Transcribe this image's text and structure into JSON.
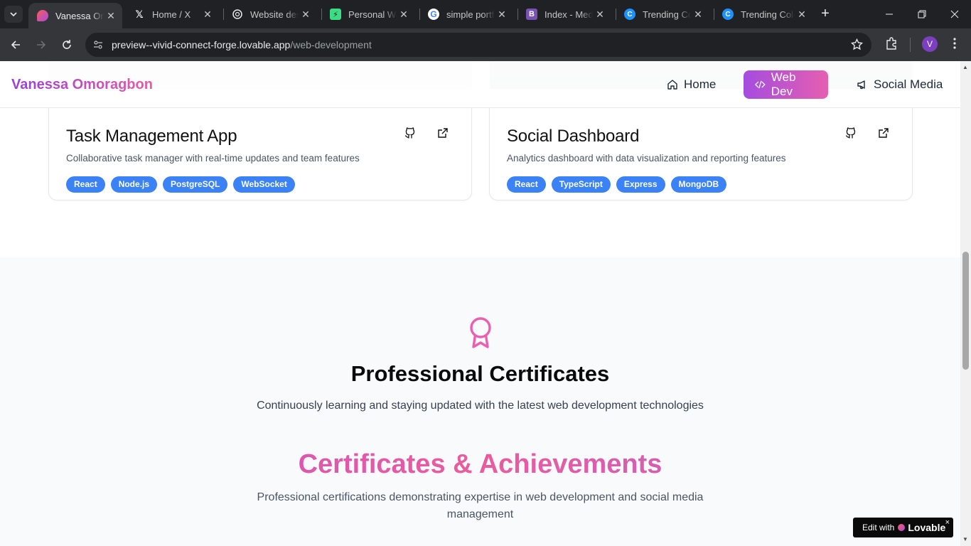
{
  "browser": {
    "tabs": [
      {
        "title": "Vanessa Omoragbon",
        "favicon": "lovable-heart-icon",
        "active": true
      },
      {
        "title": "Home / X",
        "favicon": "x-icon"
      },
      {
        "title": "Website design",
        "favicon": "openai-icon"
      },
      {
        "title": "Personal Website",
        "favicon": "builder-icon"
      },
      {
        "title": "simple portfolio",
        "favicon": "google-icon"
      },
      {
        "title": "Index - Media",
        "favicon": "bootstrap-icon"
      },
      {
        "title": "Trending Colors",
        "favicon": "coolors-icon"
      },
      {
        "title": "Trending Colors",
        "favicon": "coolors-icon"
      }
    ],
    "url_host": "preview--vivid-connect-forge.lovable.app",
    "url_path": "/web-development",
    "profile_initial": "V"
  },
  "site": {
    "brand": "Vanessa Omoragbon",
    "nav": [
      {
        "label": "Home",
        "icon": "home-icon"
      },
      {
        "label": "Web Dev",
        "icon": "code-icon",
        "active": true
      },
      {
        "label": "Social Media",
        "icon": "megaphone-icon"
      }
    ]
  },
  "projects": [
    {
      "title": "Task Management App",
      "description": "Collaborative task manager with real-time updates and team features",
      "tags": [
        "React",
        "Node.js",
        "PostgreSQL",
        "WebSocket"
      ]
    },
    {
      "title": "Social Dashboard",
      "description": "Analytics dashboard with data visualization and reporting features",
      "tags": [
        "React",
        "TypeScript",
        "Express",
        "MongoDB"
      ]
    }
  ],
  "certificates": {
    "title": "Professional Certificates",
    "subtitle": "Continuously learning and staying updated with the latest web development technologies",
    "heading": "Certificates & Achievements",
    "heading_sub": "Professional certifications demonstrating expertise in web development and social media management"
  },
  "badge": {
    "prefix": "Edit with",
    "brand": "Lovable",
    "close": "×"
  },
  "colors": {
    "accent_purple": "#a54ce0",
    "accent_pink": "#e55fb0",
    "tag_blue": "#3b82f6"
  }
}
